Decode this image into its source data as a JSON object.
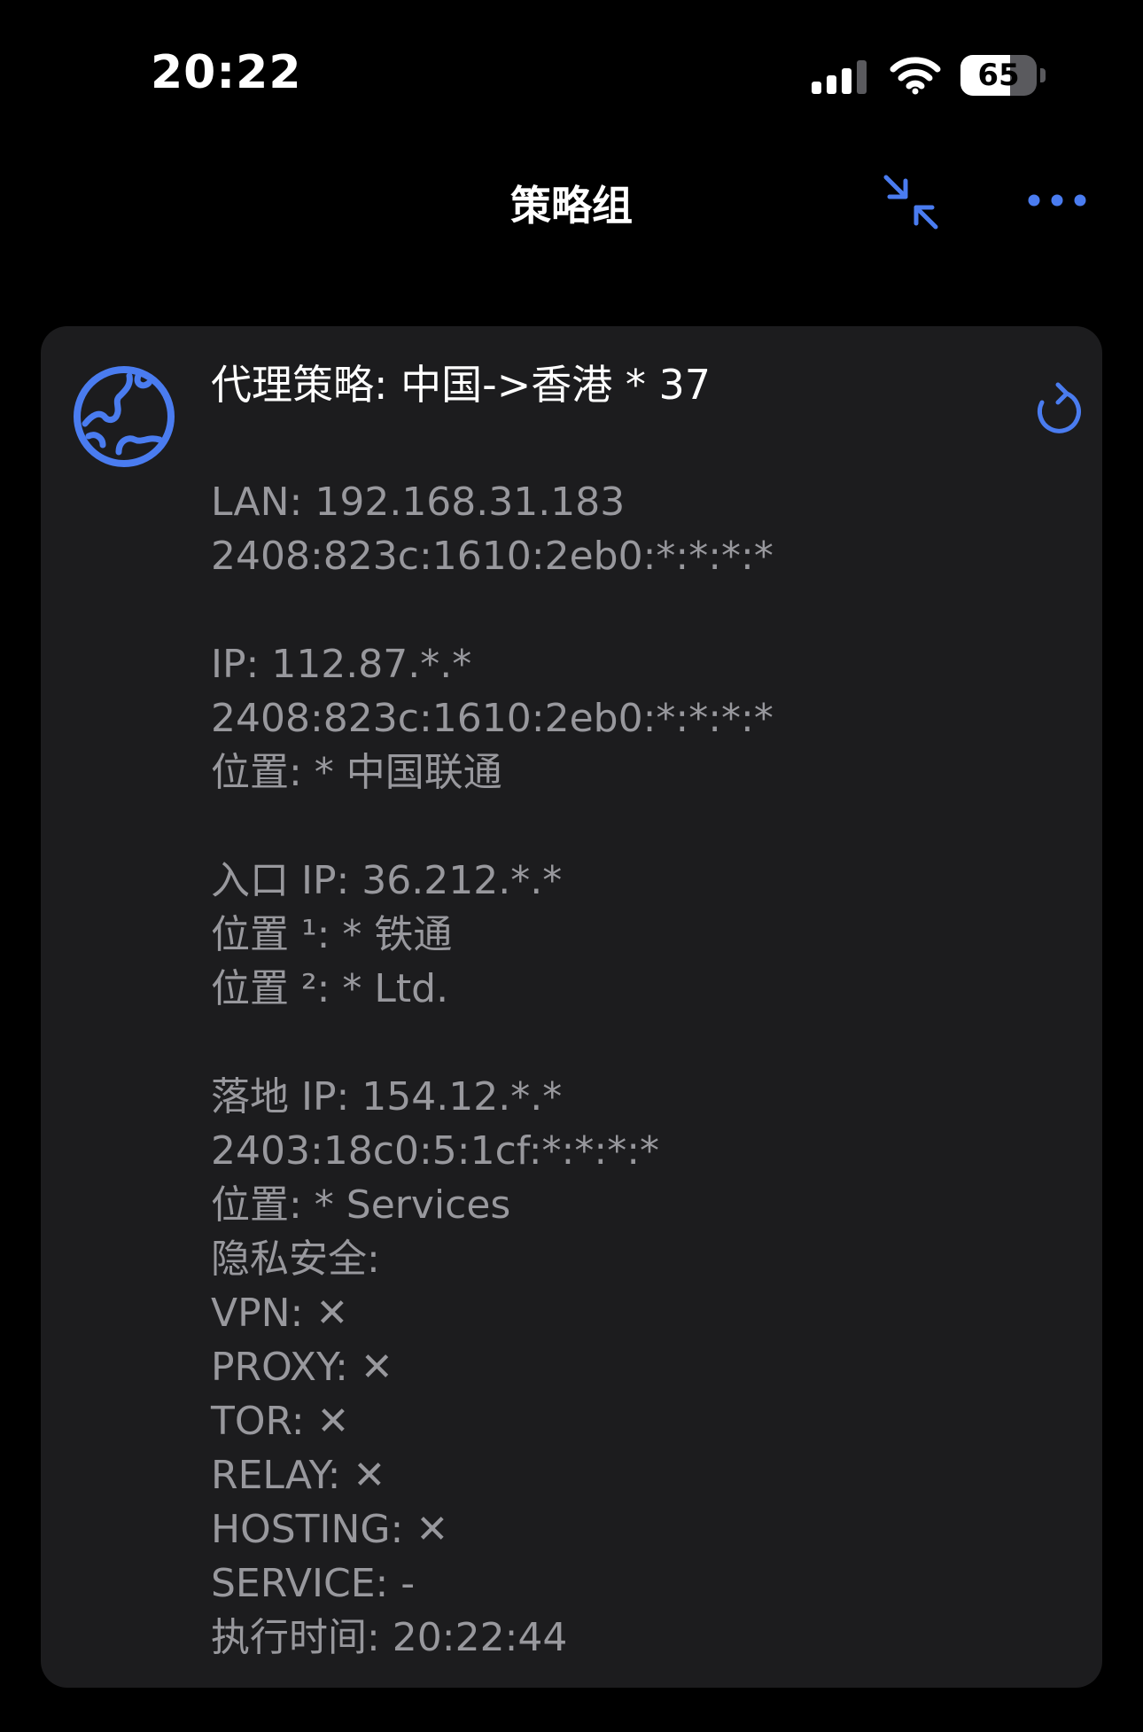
{
  "status_bar": {
    "time": "20:22",
    "battery_level": "65",
    "battery_fraction": 0.65,
    "icons": [
      "signal-icon",
      "wifi-icon",
      "battery-icon"
    ]
  },
  "nav": {
    "title": "策略组",
    "icons": [
      "collapse-icon",
      "more-icon"
    ]
  },
  "colors": {
    "accent": "#4a7cf0",
    "card_bg": "#1c1c1e",
    "secondary_text": "#98989d"
  },
  "card": {
    "title": "代理策略: 中国->香港 * 37",
    "icons": [
      "globe-icon",
      "refresh-icon"
    ],
    "lines": [
      "LAN: 192.168.31.183",
      "2408:823c:1610:2eb0:*:*:*:*",
      "",
      "IP: 112.87.*.*",
      "2408:823c:1610:2eb0:*:*:*:*",
      "位置: * 中国联通",
      "",
      "入口 IP: 36.212.*.*",
      "位置 ¹: * 铁通",
      "位置 ²: * Ltd.",
      "",
      "落地 IP: 154.12.*.*",
      "2403:18c0:5:1cf:*:*:*:*",
      "位置: * Services",
      "隐私安全:",
      "VPN: ✕",
      "PROXY: ✕",
      "TOR: ✕",
      "RELAY: ✕",
      "HOSTING: ✕",
      "SERVICE: -",
      "执行时间: 20:22:44"
    ]
  }
}
